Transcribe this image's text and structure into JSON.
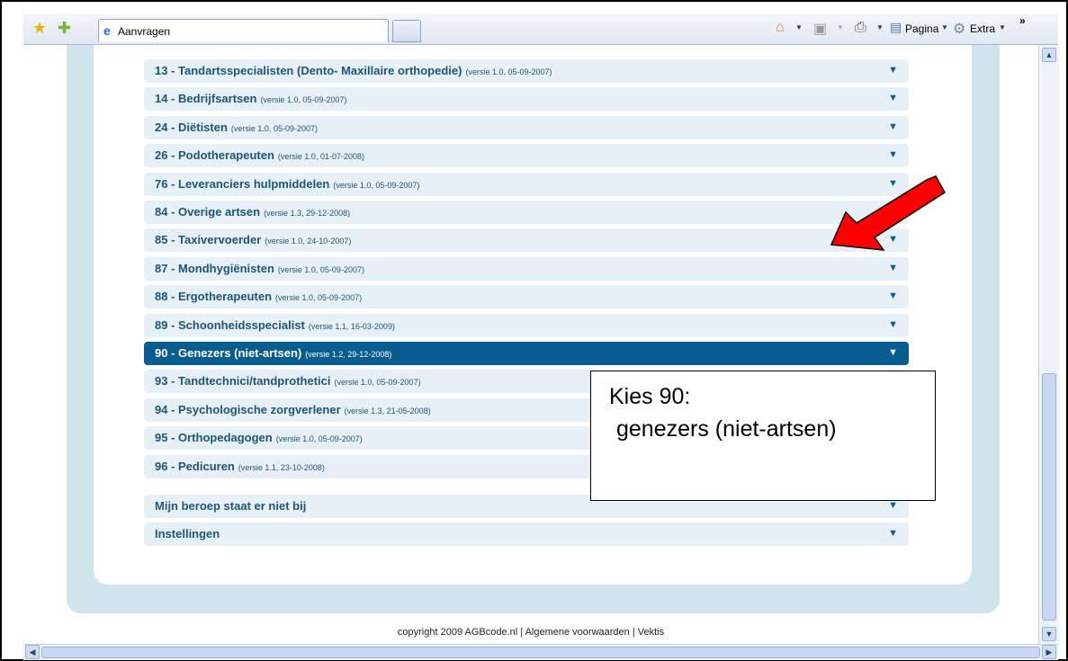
{
  "browser": {
    "tab_title": "Aanvragen",
    "more_label": "»",
    "tools": {
      "pagina_label": "Pagina",
      "extra_label": "Extra"
    }
  },
  "list": {
    "items": [
      {
        "title": "13 - Tandartsspecialisten (Dento- Maxillaire orthopedie)",
        "version": "(versie 1.0, 05-09-2007)"
      },
      {
        "title": "14 - Bedrijfsartsen",
        "version": "(versie 1.0, 05-09-2007)"
      },
      {
        "title": "24 - Diëtisten",
        "version": "(versie 1.0, 05-09-2007)"
      },
      {
        "title": "26 - Podotherapeuten",
        "version": "(versie 1.0, 01-07-2008)"
      },
      {
        "title": "76 - Leveranciers hulpmiddelen",
        "version": "(versie 1.0, 05-09-2007)"
      },
      {
        "title": "84 - Overige artsen",
        "version": "(versie 1.3, 29-12-2008)"
      },
      {
        "title": "85 - Taxivervoerder",
        "version": "(versie 1.0, 24-10-2007)"
      },
      {
        "title": "87 - Mondhygiënisten",
        "version": "(versie 1.0, 05-09-2007)"
      },
      {
        "title": "88 - Ergotherapeuten",
        "version": "(versie 1.0, 05-09-2007)"
      },
      {
        "title": "89 - Schoonheidsspecialist",
        "version": "(versie 1.1, 16-03-2009)"
      },
      {
        "title": "90 - Genezers (niet-artsen)",
        "version": "(versie 1.2, 29-12-2008)",
        "selected": true
      },
      {
        "title": "93 - Tandtechnici/tandprothetici",
        "version": "(versie 1.0, 05-09-2007)"
      },
      {
        "title": "94 - Psychologische zorgverlener",
        "version": "(versie 1.3, 21-05-2008)"
      },
      {
        "title": "95 - Orthopedagogen",
        "version": "(versie 1.0, 05-09-2007)"
      },
      {
        "title": "96 - Pedicuren",
        "version": "(versie 1.1, 23-10-2008)"
      }
    ],
    "extra_items": [
      {
        "title": "Mijn beroep staat er niet bij"
      },
      {
        "title": "Instellingen"
      }
    ],
    "expand_glyph": "▼"
  },
  "footer": {
    "text": "copyright 2009 AGBcode.nl | Algemene voorwaarden | Vektis"
  },
  "callout": {
    "line1": "Kies 90:",
    "line2": "genezers (niet-artsen)"
  },
  "colors": {
    "selected_row": "#075b8f",
    "row": "#e6f0f6",
    "panel": "#cfe4ec",
    "annotation_arrow": "#ff0000"
  }
}
